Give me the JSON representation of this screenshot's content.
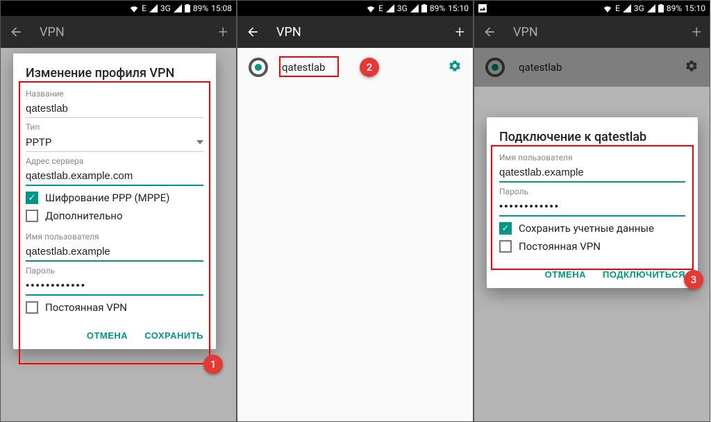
{
  "status": {
    "net3g": "3G",
    "netE": "E",
    "battery": "89%"
  },
  "times": [
    "15:08",
    "15:10",
    "15:10"
  ],
  "appbar": {
    "title": "VPN"
  },
  "vpn_row": {
    "name": "qatestlab"
  },
  "dialog1": {
    "title": "Изменение профиля VPN",
    "name_label": "Название",
    "name_value": "qatestlab",
    "type_label": "Тип",
    "type_value": "PPTP",
    "server_label": "Адрес сервера",
    "server_value": "qatestlab.example.com",
    "mppe_label": "Шифрование PPP (MPPE)",
    "advanced_label": "Дополнительно",
    "user_label": "Имя пользователя",
    "user_value": "qatestlab.example",
    "pass_label": "Пароль",
    "pass_value": "••••••••••••",
    "always_label": "Постоянная VPN",
    "cancel": "ОТМЕНА",
    "save": "СОХРАНИТЬ"
  },
  "dialog3": {
    "title": "Подключение к qatestlab",
    "user_label": "Имя пользователя",
    "user_value": "qatestlab.example",
    "pass_label": "Пароль",
    "pass_value": "••••••••••••",
    "savecred_label": "Сохранить учетные данные",
    "always_label": "Постоянная VPN",
    "cancel": "ОТМЕНА",
    "connect": "ПОДКЛЮЧИТЬСЯ"
  },
  "annotations": [
    "1",
    "2",
    "3"
  ]
}
